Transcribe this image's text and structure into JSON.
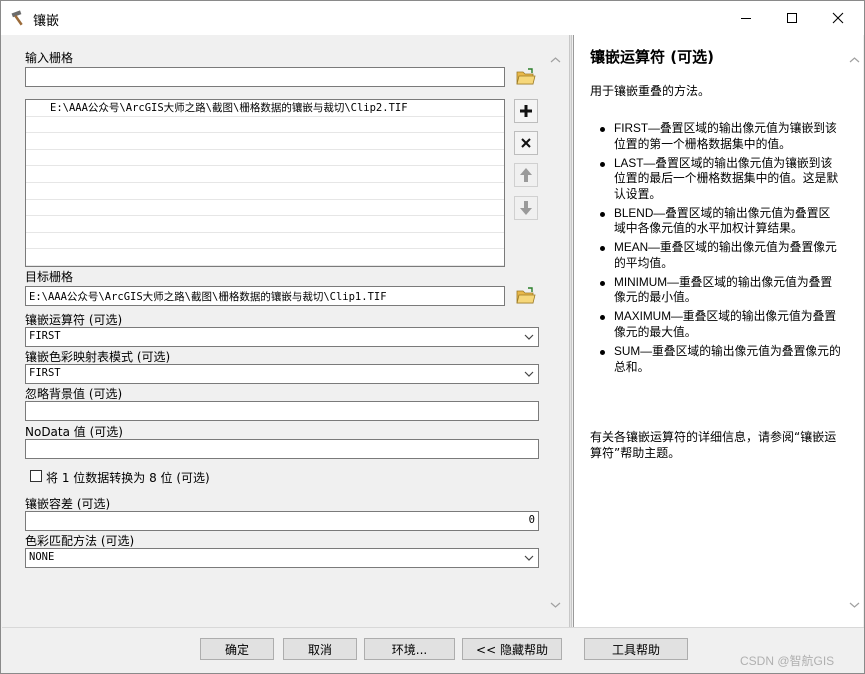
{
  "window": {
    "title": "镶嵌"
  },
  "form": {
    "input_rasters": {
      "label": "输入栅格",
      "value": "",
      "list_items": [
        "E:\\AAA公众号\\ArcGIS大师之路\\截图\\栅格数据的镶嵌与裁切\\Clip2.TIF"
      ]
    },
    "target_raster": {
      "label": "目标栅格",
      "value": "E:\\AAA公众号\\ArcGIS大师之路\\截图\\栅格数据的镶嵌与裁切\\Clip1.TIF"
    },
    "mosaic_operator": {
      "label": "镶嵌运算符 (可选)",
      "value": "FIRST"
    },
    "colormap_mode": {
      "label": "镶嵌色彩映射表模式 (可选)",
      "value": "FIRST"
    },
    "ignore_background": {
      "label": "忽略背景值 (可选)",
      "value": ""
    },
    "nodata": {
      "label": "NoData 值 (可选)",
      "value": ""
    },
    "convert_1bit": {
      "label": "将 1 位数据转换为 8 位 (可选)",
      "checked": false
    },
    "mosaic_tolerance": {
      "label": "镶嵌容差 (可选)",
      "value": "0"
    },
    "color_matching": {
      "label": "色彩匹配方法 (可选)",
      "value": "NONE"
    }
  },
  "help": {
    "title": "镶嵌运算符 (可选)",
    "intro": "用于镶嵌重叠的方法。",
    "items": [
      "FIRST—叠置区域的输出像元值为镶嵌到该位置的第一个栅格数据集中的值。",
      "LAST—叠置区域的输出像元值为镶嵌到该位置的最后一个栅格数据集中的值。这是默认设置。",
      "BLEND—叠置区域的输出像元值为叠置区域中各像元值的水平加权计算结果。",
      "MEAN—重叠区域的输出像元值为叠置像元的平均值。",
      "MINIMUM—重叠区域的输出像元值为叠置像元的最小值。",
      "MAXIMUM—重叠区域的输出像元值为叠置像元的最大值。",
      "SUM—重叠区域的输出像元值为叠置像元的总和。"
    ],
    "footer": "有关各镶嵌运算符的详细信息，请参阅“镶嵌运算符”帮助主题。"
  },
  "buttons": {
    "ok": "确定",
    "cancel": "取消",
    "environments": "环境...",
    "hide_help": "<< 隐藏帮助",
    "tool_help": "工具帮助"
  },
  "watermark": "CSDN @智航GIS"
}
